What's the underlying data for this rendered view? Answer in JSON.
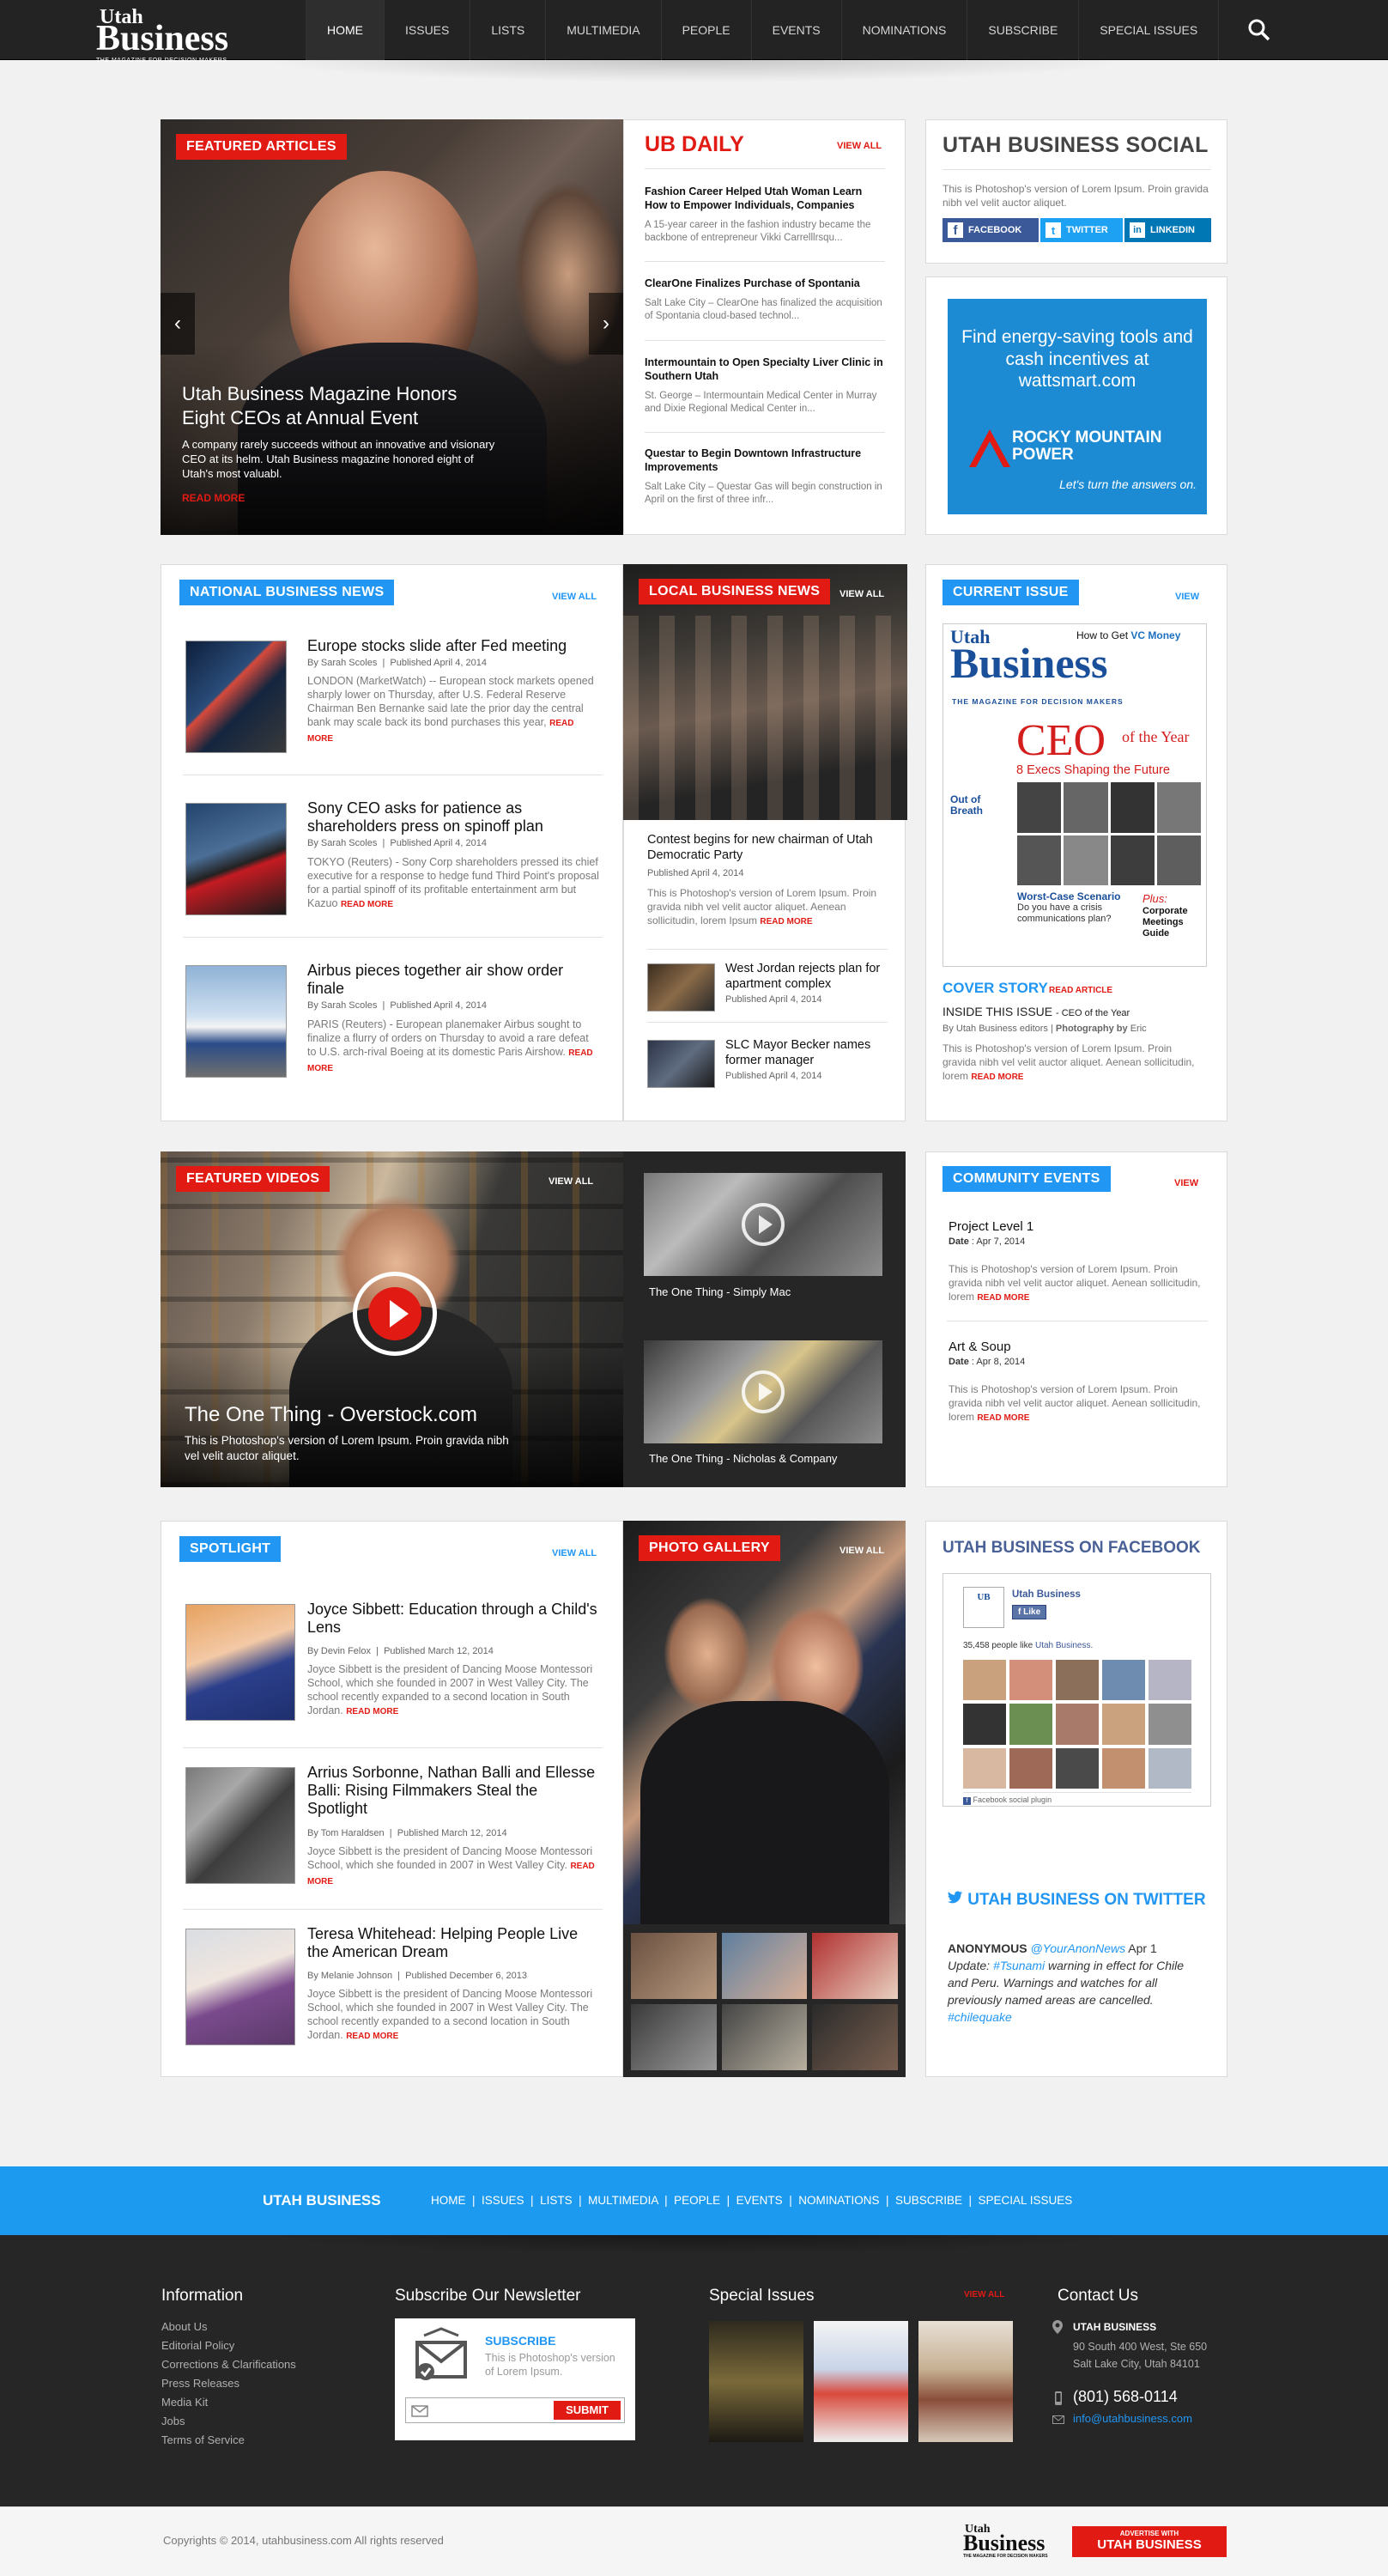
{
  "header": {
    "logo_top": "Utah",
    "logo_main": "Business",
    "logo_tag": "THE MAGAZINE FOR DECISION MAKERS",
    "nav": [
      "HOME",
      "ISSUES",
      "LISTS",
      "MULTIMEDIA",
      "PEOPLE",
      "EVENTS",
      "NOMINATIONS",
      "SUBSCRIBE",
      "SPECIAL ISSUES"
    ]
  },
  "featured": {
    "tag": "FEATURED  ARTICLES",
    "title": "Utah Business Magazine Honors Eight CEOs at Annual Event",
    "text": "A company rarely succeeds without an innovative and visionary CEO at its helm. Utah Business magazine honored eight of Utah's most valuabl.",
    "more": "READ MORE"
  },
  "ubdaily": {
    "title": "UB DAILY",
    "viewall": "VIEW ALL",
    "items": [
      {
        "title": "Fashion Career Helped Utah Woman Learn How to Empower Individuals, Companies",
        "text": "A 15-year career in the fashion industry became the backbone of entrepreneur Vikki Carrelllrsqu..."
      },
      {
        "title": "ClearOne Finalizes Purchase of Spontania",
        "text": "Salt Lake City – ClearOne has finalized the acquisition of Spontania cloud-based technol..."
      },
      {
        "title": "Intermountain to Open Specialty Liver Clinic in Southern Utah",
        "text": "St. George – Intermountain Medical Center in Murray and Dixie Regional Medical Center in..."
      },
      {
        "title": "Questar to Begin Downtown Infrastructure Improvements",
        "text": "Salt Lake City – Questar Gas will begin construction in April on the first of three infr..."
      }
    ]
  },
  "social": {
    "title": "UTAH BUSINESS SOCIAL",
    "text": "This is Photoshop's version  of Lorem Ipsum. Proin gravida nibh vel velit auctor aliquet.",
    "buttons": [
      "FACEBOOK",
      "TWITTER",
      "LINKEDIN"
    ]
  },
  "ad": {
    "line1": "Find energy-saving tools and cash incentives at",
    "line2": "wattsmart.com",
    "brand1": "ROCKY MOUNTAIN",
    "brand2": "POWER",
    "tagline": "Let's turn the answers on."
  },
  "national": {
    "tag": "NATIONAL BUSINESS NEWS",
    "viewall": "VIEW ALL",
    "items": [
      {
        "title": "Europe stocks slide after Fed meeting",
        "author": "By Sarah Scoles",
        "date": "Published April 4, 2014",
        "text": "LONDON (MarketWatch) -- European stock markets opened sharply lower on Thursday, after U.S. Federal Reserve Chairman Ben Bernanke said late the prior day the central bank may scale back its bond purchases this year,",
        "more": "READ MORE"
      },
      {
        "title": "Sony CEO asks for patience as shareholders press on spinoff plan",
        "author": "By Sarah Scoles",
        "date": "Published April 4, 2014",
        "text": "TOKYO (Reuters) - Sony Corp shareholders pressed its chief executive for a response to hedge fund Third Point's proposal for a partial spinoff of its profitable entertainment arm but Kazuo",
        "more": "READ MORE"
      },
      {
        "title": "Airbus pieces together air show order finale",
        "author": "By Sarah Scoles",
        "date": "Published April 4, 2014",
        "text": "PARIS (Reuters) - European planemaker Airbus sought to finalize a flurry of orders on Thursday to avoid a rare defeat to U.S. arch-rival Boeing at its domestic Paris Airshow.",
        "more": "READ MORE"
      }
    ]
  },
  "local": {
    "tag": "LOCAL BUSINESS NEWS",
    "viewall": "VIEW ALL",
    "main_title": "Contest begins for new chairman of Utah Democratic Party",
    "main_date": "Published April 4, 2014",
    "main_text": "This is Photoshop's version  of Lorem Ipsum. Proin gravida nibh vel velit auctor aliquet. Aenean sollicitudin, lorem Ipsum",
    "more": "READ MORE",
    "items": [
      {
        "title": "West Jordan rejects plan for apartment complex",
        "date": "Published April 4, 2014"
      },
      {
        "title": "SLC Mayor Becker names former manager",
        "date": "Published April 4, 2014"
      }
    ]
  },
  "issue": {
    "tag": "CURRENT ISSUE",
    "viewall": "VIEW",
    "cover_top": "How to Get ",
    "cover_top2": "VC Money",
    "cover_name": "Business",
    "cover_utah": "Utah",
    "cover_tag": "THE MAGAZINE FOR DECISION MAKERS",
    "cover_ceo": "CEO",
    "cover_ofthe": "of the Year",
    "cover_sub": "8 Execs Shaping the Future",
    "cover_side1": "Out of Breath",
    "cover_side2": "Worst-Case Scenario",
    "cover_side3": "Do you have a crisis communications plan?",
    "cover_plus": "Plus:",
    "cover_plus2": "Corporate Meetings Guide",
    "story_label": "COVER STORY",
    "story_read": "READ ARTICLE",
    "inside": "INSIDE THIS ISSUE",
    "inside_sub": "- CEO of the Year",
    "by": "By",
    "editors": "Utah Business editors",
    "photo": "Photography by",
    "photog": "Eric",
    "text": "This is Photoshop's version  of Lorem Ipsum. Proin gravida nibh vel velit auctor aliquet. Aenean sollicitudin, lorem",
    "more": "READ MORE"
  },
  "videos": {
    "tag": "FEATURED VIDEOS",
    "viewall": "VIEW ALL",
    "main_title": "The One Thing - Overstock.com",
    "main_text": "This is Photoshop's version  of Lorem Ipsum. Proin gravida nibh vel velit auctor aliquet.",
    "items": [
      "The One Thing - Simply Mac",
      "The One Thing - Nicholas & Company"
    ]
  },
  "events": {
    "tag": "COMMUNITY EVENTS",
    "viewall": "VIEW",
    "items": [
      {
        "title": "Project Level 1",
        "date_label": "Date",
        "date": ": Apr 7, 2014",
        "text": "This is Photoshop's version  of Lorem Ipsum. Proin gravida nibh vel velit auctor aliquet. Aenean sollicitudin, lorem",
        "more": "READ MORE"
      },
      {
        "title": "Art & Soup",
        "date_label": "Date",
        "date": ": Apr 8, 2014",
        "text": "This is Photoshop's version  of Lorem Ipsum. Proin gravida nibh vel velit auctor aliquet. Aenean sollicitudin, lorem",
        "more": "READ MORE"
      }
    ]
  },
  "spotlight": {
    "tag": "SPOTLIGHT",
    "viewall": "VIEW ALL",
    "items": [
      {
        "title": "Joyce Sibbett: Education through a Child's Lens",
        "author": "By Devin Felox",
        "date": "Published March 12, 2014",
        "text": "Joyce Sibbett is the president of Dancing Moose Montessori School, which she founded in 2007 in West Valley City. The school recently expanded to a second location in South Jordan.",
        "more": "READ MORE"
      },
      {
        "title": "Arrius Sorbonne, Nathan Balli and Ellesse Balli: Rising Filmmakers Steal the Spotlight",
        "author": "By Tom Haraldsen",
        "date": "Published March 12, 2014",
        "text": "Joyce Sibbett is the president of Dancing Moose Montessori School, which she founded in 2007 in West Valley City.",
        "more": "READ MORE"
      },
      {
        "title": "Teresa Whitehead: Helping People Live the American Dream",
        "author": "By Melanie Johnson",
        "date": "Published December 6, 2013",
        "text": "Joyce Sibbett is the president of Dancing Moose Montessori School, which she founded in 2007 in West Valley City. The school recently expanded to a second location in South Jordan.",
        "more": "READ MORE"
      }
    ]
  },
  "gallery": {
    "tag": "PHOTO GALLERY",
    "viewall": "VIEW ALL"
  },
  "facebook": {
    "title": "UTAH BUSINESS ON FACEBOOK",
    "page": "Utah Business",
    "like": "Like",
    "count": "35,458",
    "count_text": "people like",
    "count_link": "Utah Business.",
    "plugin": "Facebook social plugin"
  },
  "twitter": {
    "title": "UTAH BUSINESS ON TWITTER",
    "name": "ANONYMOUS",
    "handle": "@YourAnonNews",
    "date": "Apr 1",
    "update": "Update:",
    "hashtag": "#Tsunami",
    "text": "warning in effect for Chile and Peru. Warnings and watches for all previously named areas are cancelled.",
    "hashtag2": "#chilequake"
  },
  "bluebar": {
    "brand": "UTAH BUSINESS",
    "links": [
      "HOME",
      "ISSUES",
      "LISTS",
      "MULTIMEDIA",
      "PEOPLE",
      "EVENTS",
      "NOMINATIONS",
      "SUBSCRIBE",
      "SPECIAL ISSUES"
    ]
  },
  "footer": {
    "info_title": "Information",
    "info_links": [
      "About Us",
      "Editorial Policy",
      "Corrections & Clarifications",
      "Press Releases",
      "Media Kit",
      "Jobs",
      "Terms of Service"
    ],
    "news_title": "Subscribe Our Newsletter",
    "news_sub": "SUBSCRIBE",
    "news_text": "This is Photoshop's version  of Lorem Ipsum.",
    "news_btn": "SUBMIT",
    "special_title": "Special Issues",
    "special_view": "VIEW ALL",
    "contact_title": "Contact Us",
    "company": "UTAH BUSINESS",
    "addr1": "90 South 400 West, Ste 650",
    "addr2": "Salt Lake City, Utah 84101",
    "phone": "(801) 568-0114",
    "email": "info@utahbusiness.com"
  },
  "bottom": {
    "copyright": "Copyrights © 2014, utahbusiness.com All rights reserved",
    "adv1": "ADVERTISE WITH",
    "adv2": "UTAH BUSINESS"
  },
  "colors": {
    "red": "#e11a14",
    "blue": "#2196f3",
    "dark": "#232323"
  }
}
